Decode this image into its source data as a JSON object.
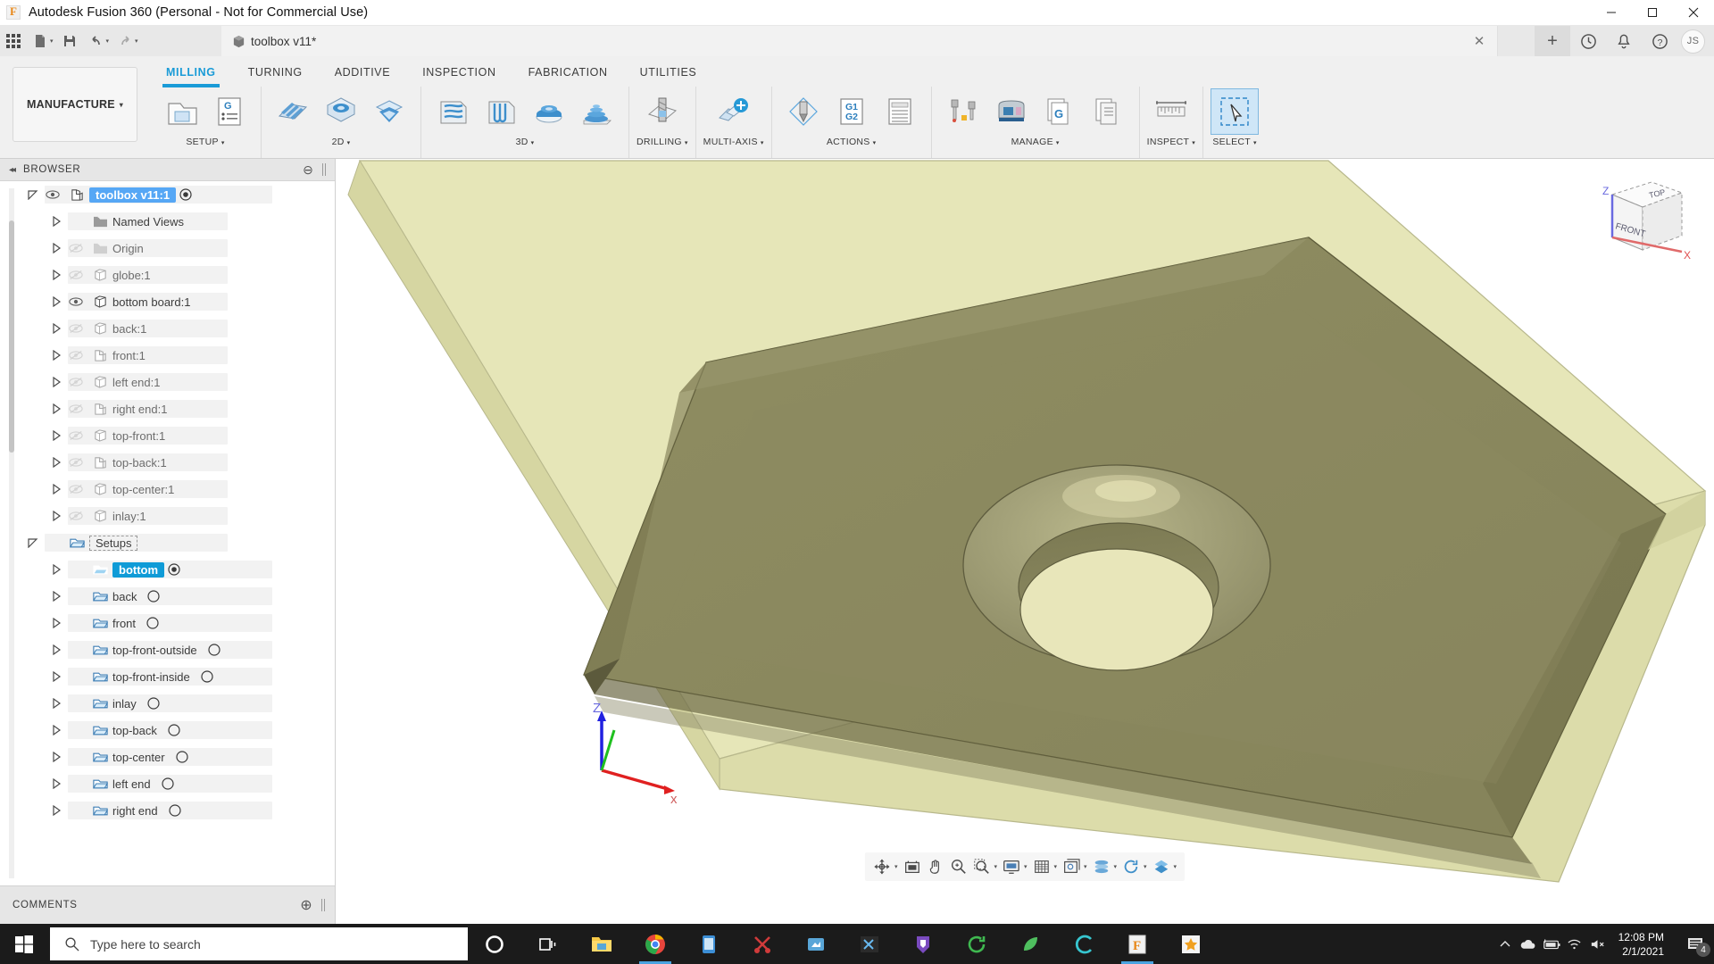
{
  "window": {
    "title": "Autodesk Fusion 360 (Personal - Not for Commercial Use)",
    "app_icon": "fusion-logo-icon",
    "minimize_label": "Minimize",
    "maximize_label": "Maximize",
    "close_label": "Close"
  },
  "quickaccess": {
    "grid_label": "show-data-panel",
    "new_label": "New",
    "save_label": "Save",
    "undo_label": "Undo",
    "redo_label": "Redo"
  },
  "doctab": {
    "name": "toolbox v11*",
    "close_label": "✕",
    "icon": "document-cube-icon"
  },
  "topright": {
    "new_tab_label": "+",
    "history_label": "job-status-icon",
    "notifications_label": "bell-icon",
    "help_label": "help-icon",
    "avatar_initials": "JS"
  },
  "ribbon": {
    "workspace": "MANUFACTURE",
    "workspace_caret": "▾",
    "tabs": [
      {
        "label": "MILLING",
        "active": true
      },
      {
        "label": "TURNING",
        "active": false
      },
      {
        "label": "ADDITIVE",
        "active": false
      },
      {
        "label": "INSPECTION",
        "active": false
      },
      {
        "label": "FABRICATION",
        "active": false
      },
      {
        "label": "UTILITIES",
        "active": false
      }
    ],
    "panels": [
      {
        "label": "SETUP",
        "caret": "▾",
        "buttons": [
          "setup-icon",
          "generate-nc-icon"
        ]
      },
      {
        "label": "2D",
        "caret": "▾",
        "buttons": [
          "face-icon",
          "pocket-icon",
          "chamfer-2d-icon"
        ]
      },
      {
        "label": "3D",
        "caret": "▾",
        "buttons": [
          "adaptive-clearing-icon",
          "parallel-icon",
          "scallop-icon",
          "spiral-icon"
        ]
      },
      {
        "label": "DRILLING",
        "caret": "▾",
        "buttons": [
          "drill-icon"
        ]
      },
      {
        "label": "MULTI-AXIS",
        "caret": "▾",
        "buttons": [
          "multi-axis-icon"
        ]
      },
      {
        "label": "ACTIONS",
        "caret": "▾",
        "buttons": [
          "simulate-icon",
          "g1-g2-icon",
          "setup-sheet-icon"
        ]
      },
      {
        "label": "MANAGE",
        "caret": "▾",
        "buttons": [
          "tool-library-icon",
          "machine-library-icon",
          "post-library-icon",
          "nc-programs-icon"
        ]
      },
      {
        "label": "INSPECT",
        "caret": "▾",
        "buttons": [
          "measure-icon"
        ]
      },
      {
        "label": "SELECT",
        "caret": "▾",
        "buttons": [
          "select-cursor-icon"
        ],
        "selected_index": 0
      }
    ]
  },
  "browser": {
    "header": "BROWSER",
    "collapse_label": "◂◂",
    "panel_button": "⊖",
    "tree": [
      {
        "label": "toolbox v11:1",
        "indent": 0,
        "twisty": "open",
        "eye": "visible",
        "icon": "component-icon",
        "selected": "blue",
        "radio": "filled",
        "bold": true
      },
      {
        "label": "Named Views",
        "indent": 1,
        "twisty": "closed",
        "eye": "none",
        "icon": "folder-icon"
      },
      {
        "label": "Origin",
        "indent": 1,
        "twisty": "closed",
        "eye": "hidden",
        "icon": "folder-icon"
      },
      {
        "label": "globe:1",
        "indent": 1,
        "twisty": "closed",
        "eye": "hidden",
        "icon": "body-icon"
      },
      {
        "label": "bottom board:1",
        "indent": 1,
        "twisty": "closed",
        "eye": "visible",
        "icon": "body-icon"
      },
      {
        "label": "back:1",
        "indent": 1,
        "twisty": "closed",
        "eye": "hidden",
        "icon": "body-icon"
      },
      {
        "label": "front:1",
        "indent": 1,
        "twisty": "closed",
        "eye": "hidden",
        "icon": "component-icon"
      },
      {
        "label": "left end:1",
        "indent": 1,
        "twisty": "closed",
        "eye": "hidden",
        "icon": "body-icon"
      },
      {
        "label": "right end:1",
        "indent": 1,
        "twisty": "closed",
        "eye": "hidden",
        "icon": "component-icon"
      },
      {
        "label": "top-front:1",
        "indent": 1,
        "twisty": "closed",
        "eye": "hidden",
        "icon": "body-icon"
      },
      {
        "label": "top-back:1",
        "indent": 1,
        "twisty": "closed",
        "eye": "hidden",
        "icon": "component-icon"
      },
      {
        "label": "top-center:1",
        "indent": 1,
        "twisty": "closed",
        "eye": "hidden",
        "icon": "body-icon"
      },
      {
        "label": "inlay:1",
        "indent": 1,
        "twisty": "closed",
        "eye": "hidden",
        "icon": "body-icon"
      },
      {
        "label": "Setups",
        "indent": 0,
        "twisty": "open",
        "eye": "none",
        "icon": "setup-folder-icon",
        "dashed": true
      },
      {
        "label": "bottom",
        "indent": 1,
        "twisty": "closed",
        "eye": "none",
        "icon": "setup-folder-icon",
        "selected": "cyan",
        "radio": "filled",
        "bold": true
      },
      {
        "label": "back",
        "indent": 1,
        "twisty": "closed",
        "eye": "none",
        "icon": "setup-folder-icon",
        "radio": "empty"
      },
      {
        "label": "front",
        "indent": 1,
        "twisty": "closed",
        "eye": "none",
        "icon": "setup-folder-icon",
        "radio": "empty"
      },
      {
        "label": "top-front-outside",
        "indent": 1,
        "twisty": "closed",
        "eye": "none",
        "icon": "setup-folder-icon",
        "radio": "empty"
      },
      {
        "label": "top-front-inside",
        "indent": 1,
        "twisty": "closed",
        "eye": "none",
        "icon": "setup-folder-icon",
        "radio": "empty"
      },
      {
        "label": "inlay",
        "indent": 1,
        "twisty": "closed",
        "eye": "none",
        "icon": "setup-folder-icon",
        "radio": "empty"
      },
      {
        "label": "top-back",
        "indent": 1,
        "twisty": "closed",
        "eye": "none",
        "icon": "setup-folder-icon",
        "radio": "empty"
      },
      {
        "label": "top-center",
        "indent": 1,
        "twisty": "closed",
        "eye": "none",
        "icon": "setup-folder-icon",
        "radio": "empty"
      },
      {
        "label": "left end",
        "indent": 1,
        "twisty": "closed",
        "eye": "none",
        "icon": "setup-folder-icon",
        "radio": "empty"
      },
      {
        "label": "right end",
        "indent": 1,
        "twisty": "closed",
        "eye": "none",
        "icon": "setup-folder-icon",
        "radio": "empty"
      }
    ]
  },
  "comments": {
    "header": "COMMENTS",
    "panel_button": "⊕"
  },
  "viewport": {
    "viewcube": {
      "top_face": "TOP",
      "front_face": "FRONT",
      "axis_z": "Z",
      "axis_x": "X"
    },
    "origin_triad": {
      "z": "Z",
      "x": "x"
    },
    "model_colors": {
      "stock_translucent": "#e3e3b4",
      "part_top": "#8d8b5f",
      "part_side": "#7c7a54",
      "bore_bottom": "#e8e6ba",
      "edge": "#5a5836"
    }
  },
  "navbar": {
    "buttons": [
      {
        "name": "orbit-icon",
        "caret": true
      },
      {
        "name": "fit-icon",
        "caret": false
      },
      {
        "name": "pan-icon",
        "caret": false
      },
      {
        "name": "zoom-icon",
        "caret": false
      },
      {
        "name": "zoom-window-icon",
        "caret": true
      },
      {
        "name": "display-settings-icon",
        "caret": true
      },
      {
        "name": "grid-snaps-icon",
        "caret": true
      },
      {
        "name": "viewports-icon",
        "caret": true
      },
      {
        "name": "visual-style-icon",
        "caret": true
      },
      {
        "name": "refresh-icon",
        "caret": true
      },
      {
        "name": "appearance-icon",
        "caret": true
      }
    ]
  },
  "taskbar": {
    "start_label": "start-button",
    "search_placeholder": "Type here to search",
    "search_value": "",
    "items": [
      {
        "name": "cortana-icon"
      },
      {
        "name": "task-view-icon"
      },
      {
        "name": "file-explorer-icon",
        "active": false
      },
      {
        "name": "google-chrome-icon",
        "active": true
      },
      {
        "name": "store-icon",
        "active": false
      },
      {
        "name": "shotcut-icon",
        "active": false
      },
      {
        "name": "paint-icon",
        "active": false
      },
      {
        "name": "vs-code-icon",
        "active": false
      },
      {
        "name": "purple-app-icon",
        "active": false
      },
      {
        "name": "green-sync-icon",
        "active": false
      },
      {
        "name": "green-leaf-icon",
        "active": false
      },
      {
        "name": "cura-icon",
        "active": false
      },
      {
        "name": "fusion-360-icon",
        "active": true
      },
      {
        "name": "star-app-icon",
        "active": false
      }
    ],
    "tray": {
      "chevron": "⌃",
      "icons": [
        "onedrive-icon",
        "battery-icon",
        "wifi-icon",
        "volume-muted-icon"
      ],
      "time": "12:08 PM",
      "date": "2/1/2021",
      "notification_count": "4"
    }
  }
}
